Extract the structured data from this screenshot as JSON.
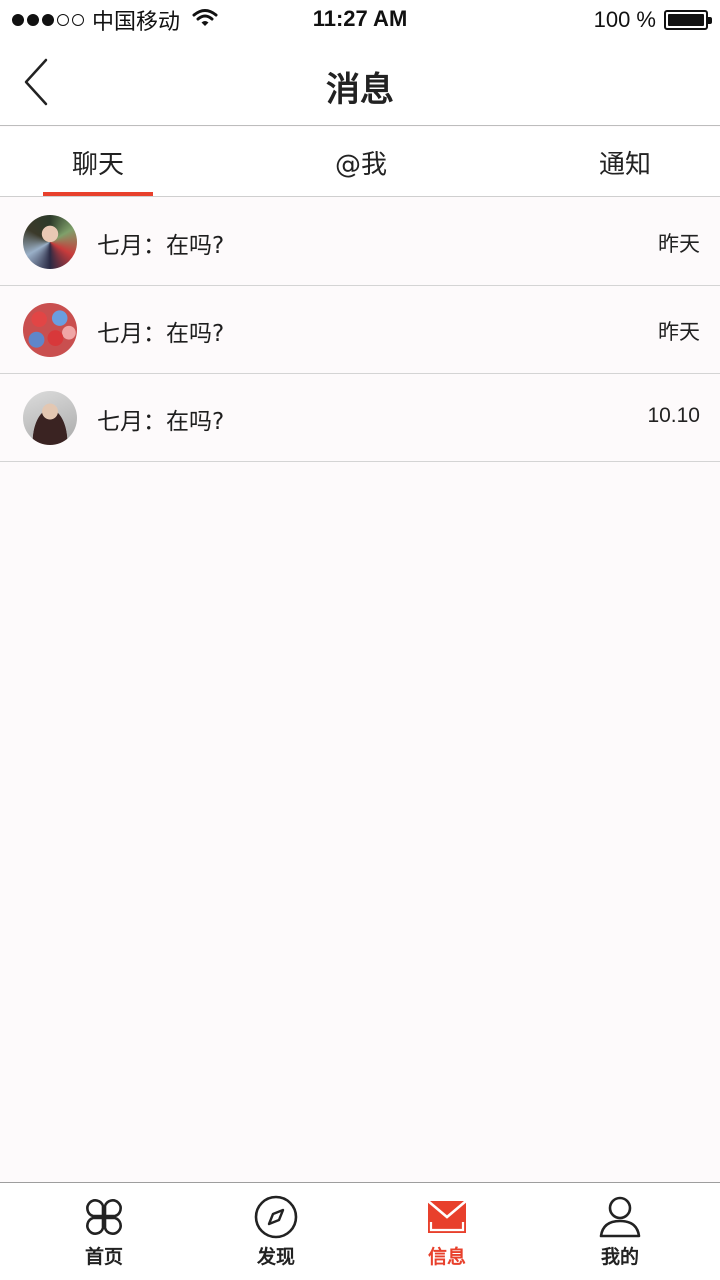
{
  "status_bar": {
    "carrier": "中国移动",
    "time": "11:27 AM",
    "battery": "100 %",
    "signal_bars_filled": 3,
    "signal_bars_total": 5
  },
  "nav": {
    "title": "消息",
    "back_icon": "chevron-left-icon"
  },
  "tabs": {
    "items": [
      {
        "label": "聊天",
        "active": true
      },
      {
        "label": "@我",
        "active": false
      },
      {
        "label": "通知",
        "active": false
      }
    ]
  },
  "conversations": [
    {
      "message": "七月：在吗?",
      "time": "昨天",
      "avatar": "avatar-woman-floral"
    },
    {
      "message": "七月：在吗?",
      "time": "昨天",
      "avatar": "avatar-colorful-balls"
    },
    {
      "message": "七月：在吗?",
      "time": "10.10",
      "avatar": "avatar-man-portrait"
    }
  ],
  "tab_bar": {
    "items": [
      {
        "label": "首页",
        "icon": "clover-icon",
        "active": false
      },
      {
        "label": "发现",
        "icon": "compass-icon",
        "active": false
      },
      {
        "label": "信息",
        "icon": "mail-icon",
        "active": true
      },
      {
        "label": "我的",
        "icon": "user-icon",
        "active": false
      }
    ]
  },
  "colors": {
    "accent": "#e8402c",
    "background": "#fdfafb",
    "text": "#222222"
  }
}
